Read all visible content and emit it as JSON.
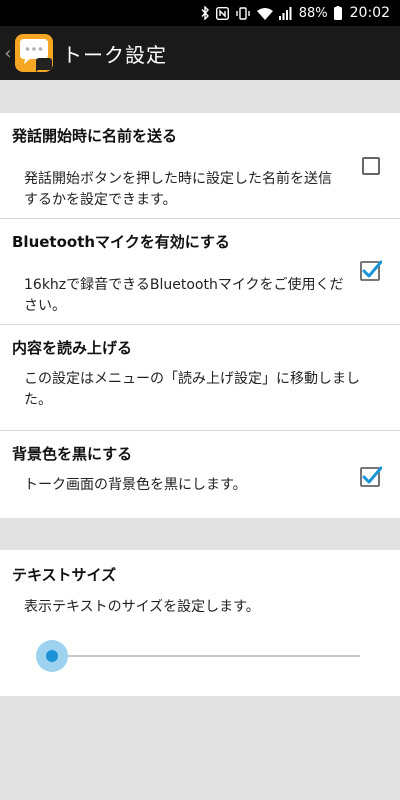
{
  "status_bar": {
    "icons": [
      "bluetooth-icon",
      "nfc-icon",
      "vibrate-icon",
      "wifi-icon",
      "signal-icon",
      "battery-icon"
    ],
    "battery": "88%",
    "time": "20:02"
  },
  "app_bar": {
    "back_glyph": "‹",
    "title": "トーク設定",
    "icon": "chat-bubble-app-icon"
  },
  "settings": [
    {
      "title": "発話開始時に名前を送る",
      "summary": "発話開始ボタンを押した時に設定した名前を送信するかを設定できます。",
      "checked": false
    },
    {
      "title": "Bluetoothマイクを有効にする",
      "summary": "16khzで録音できるBluetoothマイクをご使用ください。",
      "checked": true
    },
    {
      "title": "内容を読み上げる",
      "summary": "この設定はメニューの「読み上げ設定」に移動しました。"
    },
    {
      "title": "背景色を黒にする",
      "summary": "トーク画面の背景色を黒にします。",
      "checked": true
    }
  ],
  "text_size": {
    "title": "テキストサイズ",
    "summary": "表示テキストのサイズを設定します。",
    "slider_value": 0.0
  },
  "colors": {
    "accent": "#1a93d8",
    "app_bar": "#1a1a1a",
    "app_icon": "#f5a623"
  }
}
